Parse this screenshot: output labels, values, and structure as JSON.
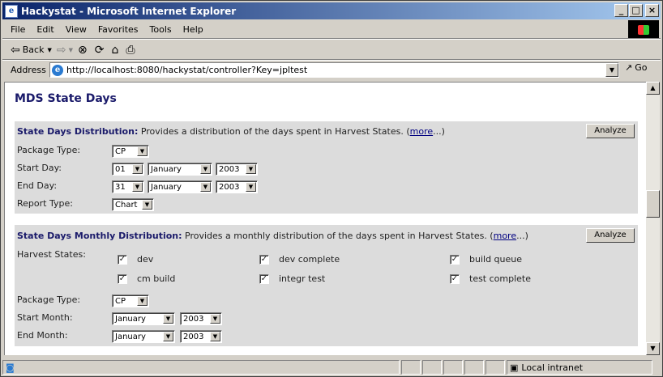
{
  "window": {
    "title": "Hackystat - Microsoft Internet Explorer"
  },
  "menu": [
    "File",
    "Edit",
    "View",
    "Favorites",
    "Tools",
    "Help"
  ],
  "toolbar": {
    "back_label": "Back"
  },
  "address": {
    "label": "Address",
    "url": "http://localhost:8080/hackystat/controller?Key=jpltest",
    "go_label": "Go"
  },
  "page": {
    "heading": "MDS State Days",
    "panel1": {
      "title": "State Days Distribution:",
      "desc": " Provides a distribution of the days spent in Harvest States. (",
      "more": "more",
      "tail": "...)",
      "analyze": "Analyze",
      "package_label": "Package Type:",
      "package_value": "CP",
      "start_label": "Start Day:",
      "start_day": "01",
      "start_month": "January",
      "start_year": "2003",
      "end_label": "End Day:",
      "end_day": "31",
      "end_month": "January",
      "end_year": "2003",
      "report_label": "Report Type:",
      "report_value": "Chart"
    },
    "panel2": {
      "title": "State Days Monthly Distribution:",
      "desc": " Provides a monthly distribution of the days spent in Harvest States. (",
      "more": "more",
      "tail": "...)",
      "analyze": "Analyze",
      "harvest_label": "Harvest States:",
      "states": [
        "dev",
        "dev complete",
        "build queue",
        "cm build",
        "integr test",
        "test complete"
      ],
      "package_label": "Package Type:",
      "package_value": "CP",
      "start_label": "Start Month:",
      "start_month": "January",
      "start_year": "2003",
      "end_label": "End Month:",
      "end_month": "January",
      "end_year": "2003"
    }
  },
  "status": {
    "zone": "Local intranet"
  }
}
